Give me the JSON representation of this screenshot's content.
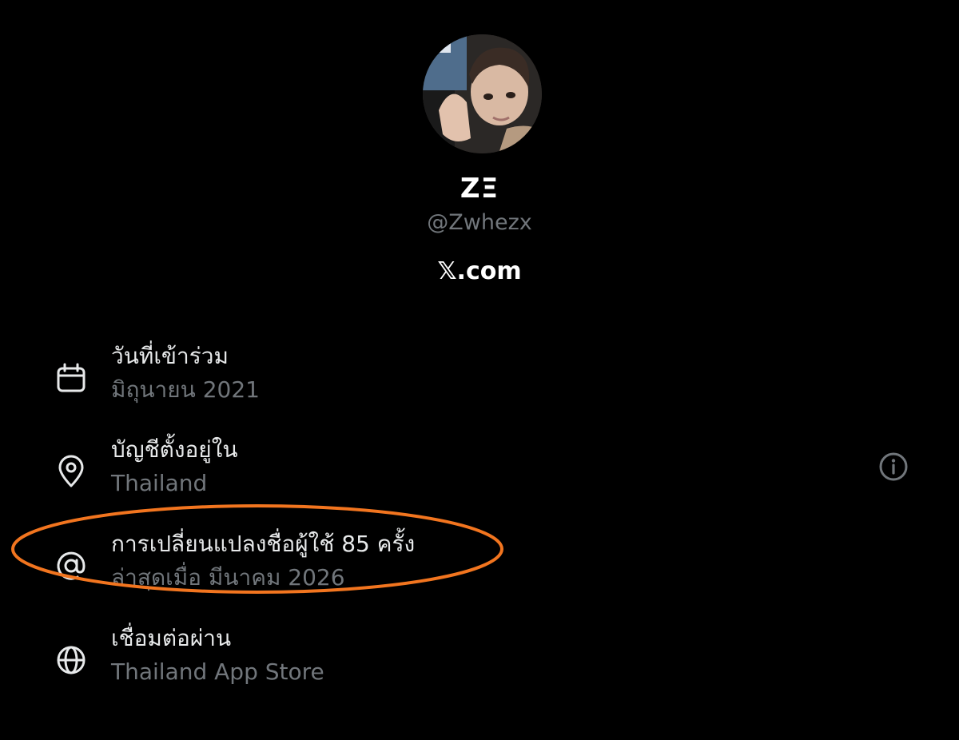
{
  "profile": {
    "avatar_icon": "profile-photo",
    "display_name": "ZΞ",
    "handle": "@Zwhezx",
    "source_domain": "𝕏.com"
  },
  "about": {
    "joined": {
      "icon": "calendar-icon",
      "title": "วันที่เข้าร่วม",
      "value": "มิถุนายน 2021"
    },
    "location": {
      "icon": "location-pin-icon",
      "title": "บัญชีตั้งอยู่ใน",
      "value": "Thailand",
      "info_icon": "info-icon"
    },
    "username_changes": {
      "icon": "at-sign-icon",
      "title": "การเปลี่ยนแปลงชื่อผู้ใช้ 85 ครั้ง",
      "value": "ล่าสุดเมื่อ มีนาคม 2026"
    },
    "connected_via": {
      "icon": "globe-icon",
      "title": "เชื่อมต่อผ่าน",
      "value": "Thailand App Store"
    }
  },
  "colors": {
    "background": "#000000",
    "primary_text": "#e7e9ea",
    "secondary_text": "#71767b",
    "highlight_annotation": "#f2751f"
  }
}
